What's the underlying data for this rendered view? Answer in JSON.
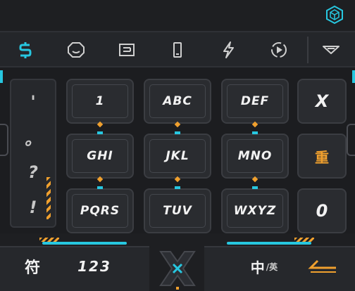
{
  "toolbar": {
    "tools": [
      {
        "icon": "dollar-s-icon",
        "active": true
      },
      {
        "icon": "emoji-face-icon"
      },
      {
        "icon": "clipboard-icon"
      },
      {
        "icon": "phone-icon"
      },
      {
        "icon": "lightning-icon"
      },
      {
        "icon": "play-circle-icon"
      },
      {
        "icon": "collapse-keyboard-icon"
      }
    ]
  },
  "symbols": [
    "'",
    "。",
    "?",
    "!"
  ],
  "keys": [
    {
      "label": "1"
    },
    {
      "label": "ABC"
    },
    {
      "label": "DEF"
    },
    {
      "label": "GHI"
    },
    {
      "label": "JKL"
    },
    {
      "label": "MNO"
    },
    {
      "label": "PQRS"
    },
    {
      "label": "TUV"
    },
    {
      "label": "WXYZ"
    }
  ],
  "side_keys": {
    "delete": "X",
    "redo": "重",
    "zero": "0"
  },
  "bottom": {
    "symbol": "符",
    "numbers": "123",
    "lang_main": "中",
    "lang_alt": "/英"
  },
  "colors": {
    "accent_cyan": "#27c7e0",
    "accent_orange": "#f0a02e",
    "background": "#1c1d20"
  }
}
